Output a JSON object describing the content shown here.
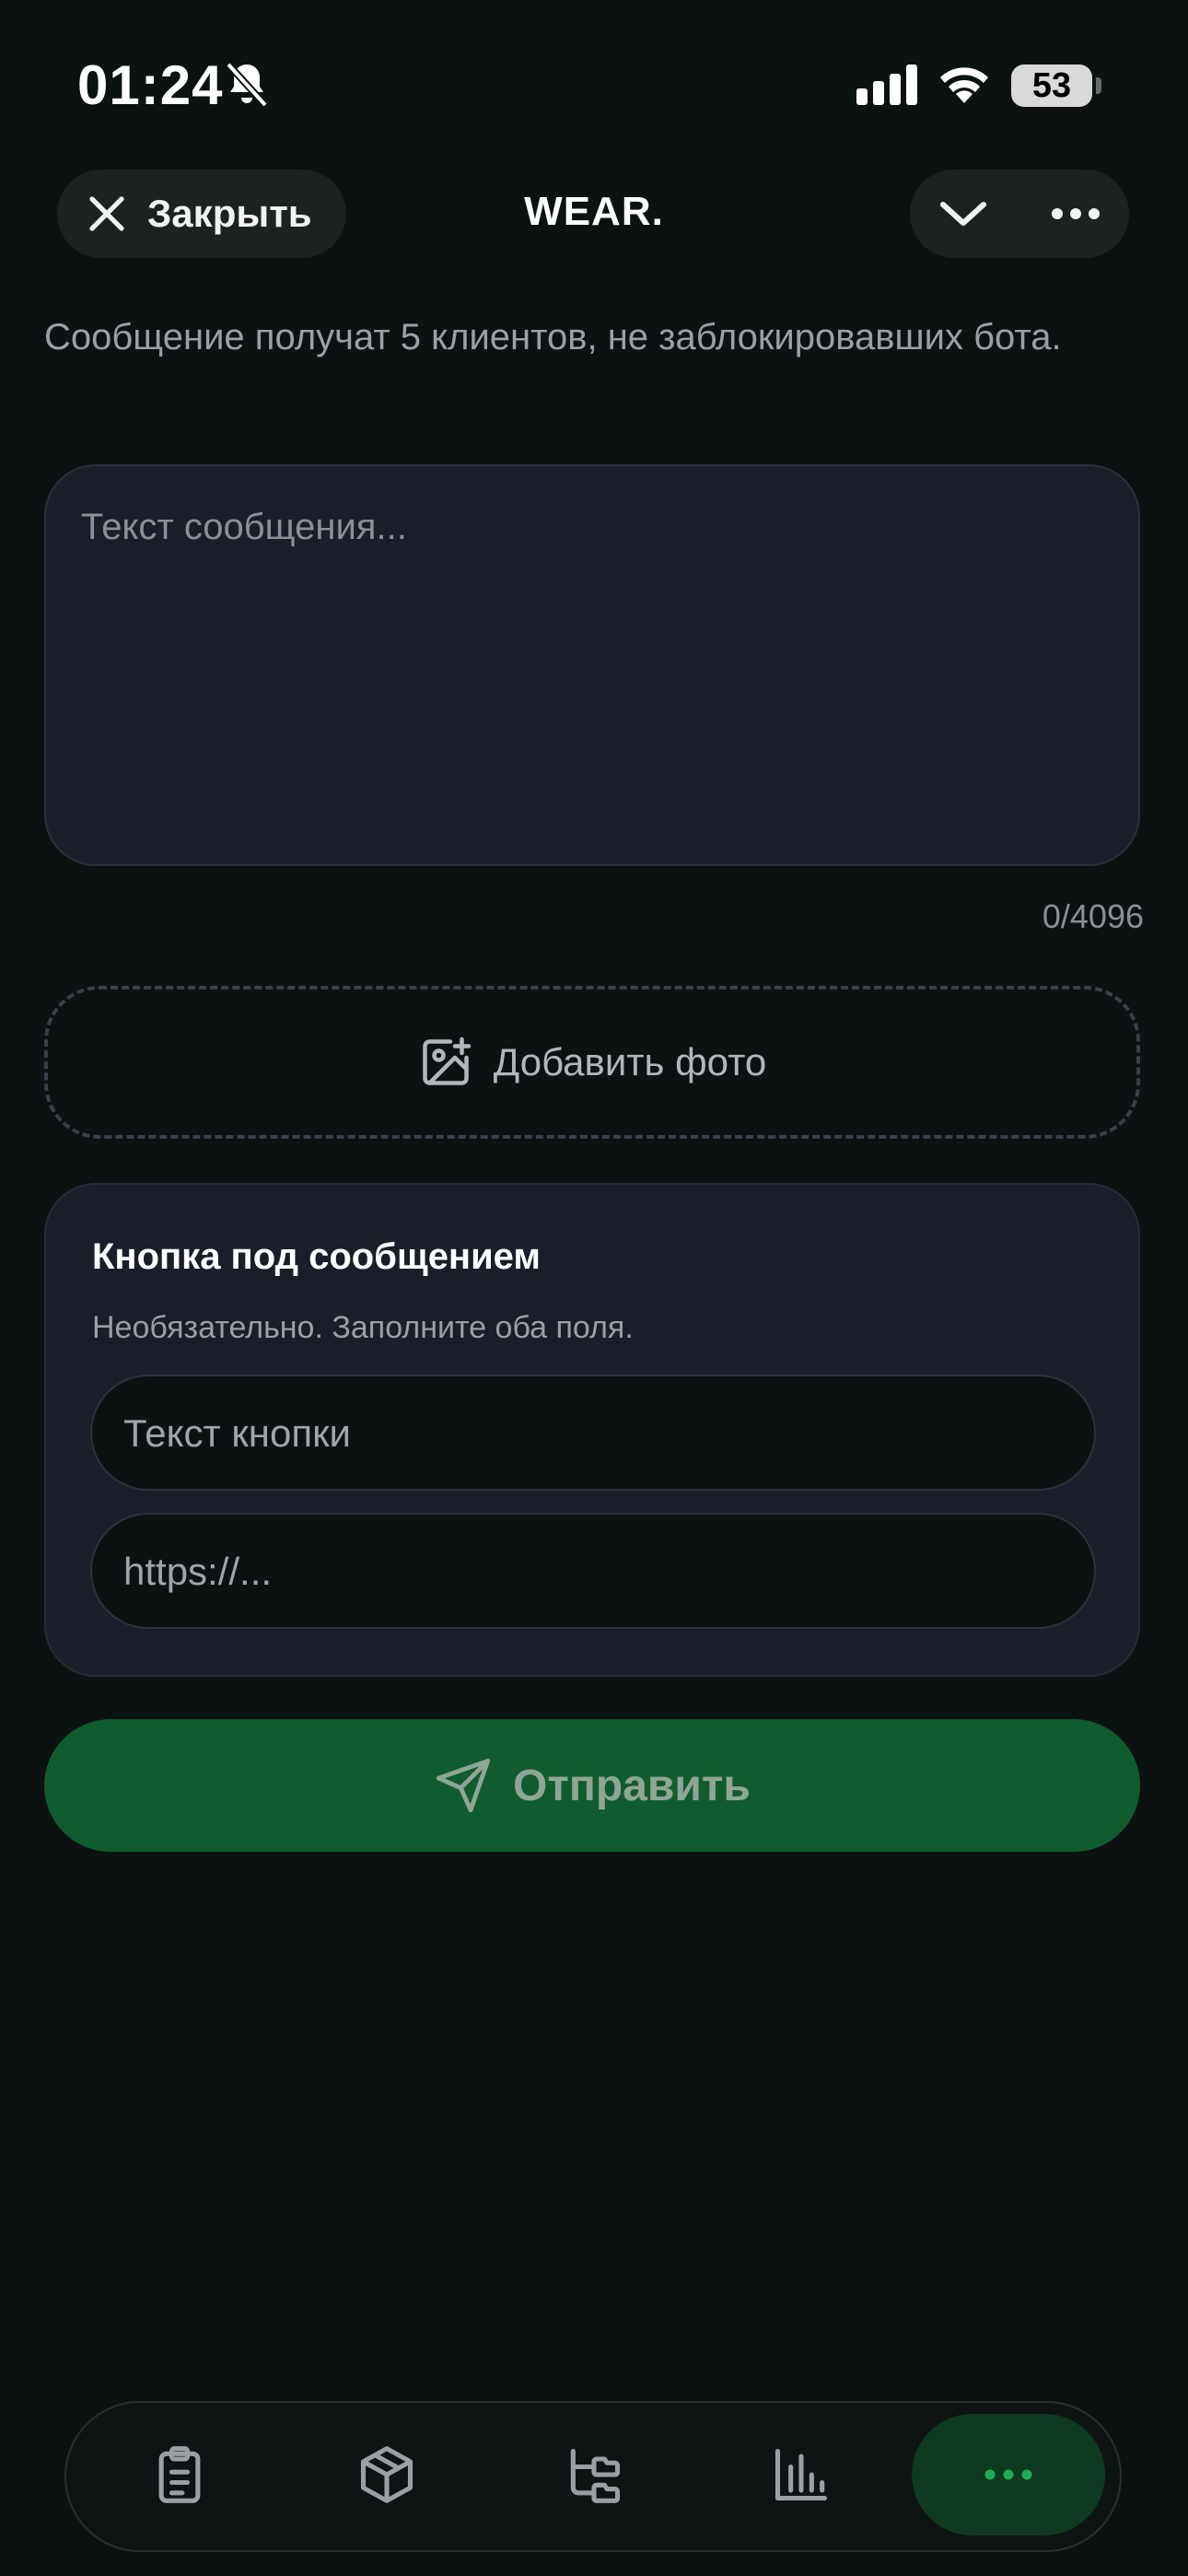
{
  "status_bar": {
    "time": "01:24",
    "battery": "53",
    "icons": [
      "bell-off-icon",
      "signal-icon",
      "wifi-icon",
      "battery-icon"
    ]
  },
  "header": {
    "close_label": "Закрыть",
    "title": "WEAR.",
    "icons": [
      "close-icon",
      "chevron-down-icon",
      "more-icon"
    ]
  },
  "broadcast": {
    "info": "Сообщение получат 5 клиентов, не заблокировавших бота.",
    "message_placeholder": "Текст сообщения...",
    "counter": "0/4096",
    "add_photo_label": "Добавить фото"
  },
  "button_card": {
    "title": "Кнопка под сообщением",
    "subtitle": "Необязательно. Заполните оба поля.",
    "text_placeholder": "Текст кнопки",
    "url_placeholder": "https://..."
  },
  "send": {
    "label": "Отправить"
  },
  "nav": {
    "items": [
      "clipboard-icon",
      "box-icon",
      "tree-icon",
      "chart-icon",
      "more-icon"
    ],
    "active": 4,
    "colors": {
      "active_bg": "#0f3a22",
      "accent": "#1fae52"
    }
  }
}
